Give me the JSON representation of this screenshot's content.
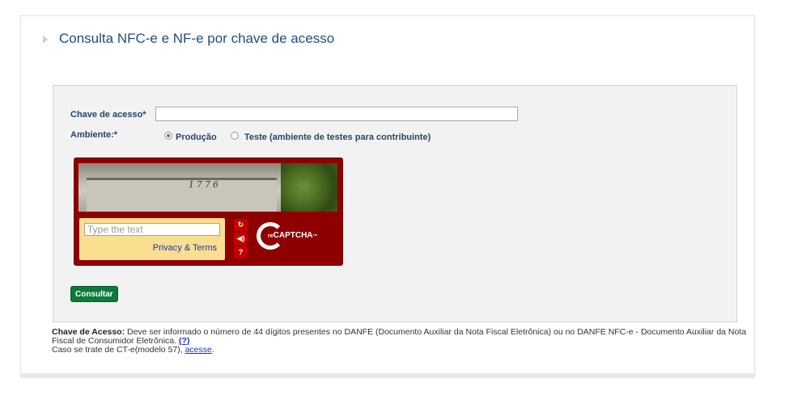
{
  "title": "Consulta NFC-e e NF-e por chave de acesso",
  "form": {
    "chave_label": "Chave de acesso*",
    "chave_value": "",
    "ambiente_label": "Ambiente:*",
    "options": [
      {
        "label": "Produção",
        "checked": true
      },
      {
        "label": "Teste (ambiente de testes para contribuinte)",
        "checked": false
      }
    ],
    "submit_label": "Consultar"
  },
  "captcha": {
    "image_text": "1776",
    "placeholder": "Type the text",
    "privacy_link": "Privacy & Terms",
    "logo_re": "re",
    "logo_text": "CAPTCHA",
    "logo_tm": "™",
    "buttons": [
      "refresh-icon",
      "audio-icon",
      "help-icon"
    ],
    "brand_color": "#8e0000"
  },
  "footer": {
    "bold_label": "Chave de Acesso:",
    "text1": " Deve ser informado o número de 44 dígitos presentes no DANFE (Documento Auxiliar da Nota Fiscal Eletrônica) ou no DANFE NFC-e - Documento Auxiliar da Nota Fiscal de Consumidor Eletrônica. ",
    "help_link": "(?)",
    "text2": "Caso se trate de CT-e(modelo 57), ",
    "acesse_link": "acesse",
    "period": "."
  }
}
